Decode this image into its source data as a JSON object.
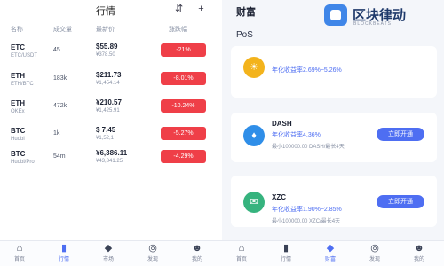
{
  "market": {
    "title": "行情",
    "header_icons": [
      "⇵",
      "+"
    ],
    "columns": [
      "名称",
      "成交量",
      "最新价",
      "涨跌幅"
    ],
    "rows": [
      {
        "symbol": "ETC",
        "name": "ETC/USDT",
        "volume": "45",
        "price": "$55.89",
        "cny": "¥378.50",
        "change": "-21%"
      },
      {
        "symbol": "ETH",
        "name": "ETH/BTC",
        "volume": "183k",
        "price": "$211.73",
        "cny": "¥1,454.14",
        "change": "-8.01%"
      },
      {
        "symbol": "ETH",
        "name": "OKEx",
        "volume": "472k",
        "price": "¥210.57",
        "cny": "¥1,425.91",
        "change": "-10.24%"
      },
      {
        "symbol": "BTC",
        "name": "Huobi",
        "volume": "1k",
        "price": "$ 7,45",
        "cny": "¥1,52,1",
        "change": "-5.27%"
      },
      {
        "symbol": "BTC",
        "name": "Huobi/Pro",
        "volume": "54m",
        "price": "¥6,386.11",
        "cny": "¥43,841.25",
        "change": "-4.29%"
      }
    ],
    "tabs": [
      {
        "label": "首页",
        "icon": "⌂"
      },
      {
        "label": "行情",
        "icon": "▮"
      },
      {
        "label": "市场",
        "icon": "◆"
      },
      {
        "label": "发现",
        "icon": "◎"
      },
      {
        "label": "我的",
        "icon": "☻"
      }
    ],
    "active_tab": 1
  },
  "finance": {
    "title": "财富",
    "logo_text": "区块律动",
    "logo_sub": "BLOCKBEATS",
    "section": "PoS",
    "cards": [
      {
        "icon": "☀",
        "icon_color": "#f3b31c",
        "title": "",
        "subtitle": "年化收益率2.69%~5.26%",
        "note": "",
        "button": ""
      },
      {
        "icon": "♦",
        "icon_color": "#2f8ee8",
        "title": "DASH",
        "subtitle": "年化收益率4.36%",
        "note": "最小100000.00 DASH/最长4天",
        "button": "立即开通"
      },
      {
        "icon": "✉",
        "icon_color": "#36b37e",
        "title": "XZC",
        "subtitle": "年化收益率1.90%~2.85%",
        "note": "最小100000.00 XZC/最长4天",
        "button": "立即开通"
      }
    ],
    "tabs": [
      {
        "label": "首页",
        "icon": "⌂"
      },
      {
        "label": "行情",
        "icon": "▮"
      },
      {
        "label": "财富",
        "icon": "◆"
      },
      {
        "label": "发现",
        "icon": "◎"
      },
      {
        "label": "我的",
        "icon": "☻"
      }
    ],
    "active_tab": 2
  }
}
